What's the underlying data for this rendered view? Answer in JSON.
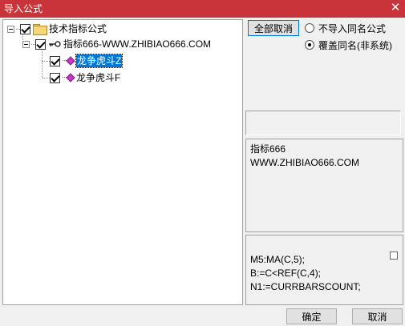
{
  "window": {
    "title": "导入公式",
    "close_glyph": "✕"
  },
  "tree": {
    "root": {
      "label": "技术指标公式",
      "checked": true,
      "icon": "folder-icon"
    },
    "group": {
      "label": "指标666-WWW.ZHIBIAO666.COM",
      "checked": true,
      "icon": "key-icon"
    },
    "items": [
      {
        "label": "龙争虎斗Z",
        "checked": true,
        "selected": true,
        "icon": "diamond-icon"
      },
      {
        "label": "龙争虎斗F",
        "checked": true,
        "selected": false,
        "icon": "diamond-icon"
      }
    ]
  },
  "options": {
    "uncheck_all_label": "全部取消",
    "radio_skip_label": "不导入同名公式",
    "radio_overwrite_label": "覆盖同名(非系统)",
    "selected_radio": "overwrite"
  },
  "info": {
    "line1": "指标666",
    "line2": "WWW.ZHIBIAO666.COM"
  },
  "code": {
    "line1": "M5:MA(C,5);",
    "line2": "B:=C<REF(C,4);",
    "line3": "N1:=CURRBARSCOUNT;"
  },
  "buttons": {
    "ok_label": "确定",
    "cancel_label": "取消"
  },
  "colors": {
    "titlebar": "#c8343a",
    "selection": "#0078d7",
    "item_icon": "#cc33cc"
  }
}
